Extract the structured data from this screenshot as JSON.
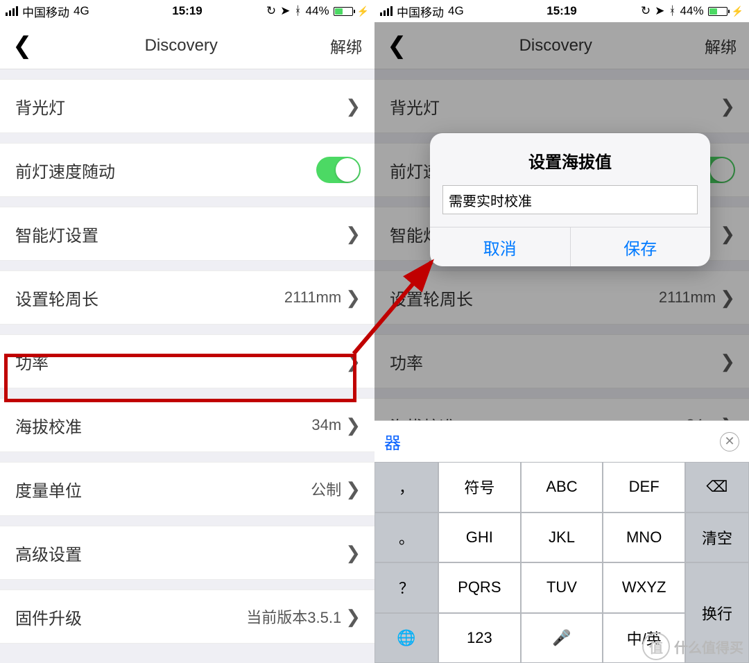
{
  "statusbar": {
    "carrier": "中国移动",
    "net": "4G",
    "time": "15:19",
    "batt": "44%"
  },
  "nav": {
    "title": "Discovery",
    "unbind": "解绑"
  },
  "rows": {
    "backlight": "背光灯",
    "headlight_speed": "前灯速度随动",
    "smart_light": "智能灯设置",
    "wheel": {
      "label": "设置轮周长",
      "value": "2111mm"
    },
    "power": "功率",
    "altitude": {
      "label": "海拔校准",
      "value": "34m"
    },
    "units": {
      "label": "度量单位",
      "value": "公制"
    },
    "advanced": "高级设置",
    "firmware": {
      "label": "固件升级",
      "value": "当前版本3.5.1"
    }
  },
  "dialog": {
    "title": "设置海拔值",
    "input": "需要实时校准",
    "cancel": "取消",
    "save": "保存"
  },
  "candidate": "器",
  "keys": {
    "comma": "，",
    "fuhao": "符号",
    "abc": "ABC",
    "def": "DEF",
    "dot": "。",
    "ghi": "GHI",
    "jkl": "JKL",
    "mno": "MNO",
    "clear": "清空",
    "q": "？",
    "pqrs": "PQRS",
    "tuv": "TUV",
    "wxyz": "WXYZ",
    "n123": "123",
    "zh": "中/英",
    "newline": "换行"
  },
  "watermark": {
    "zhi": "值",
    "text": "什么值得买"
  }
}
